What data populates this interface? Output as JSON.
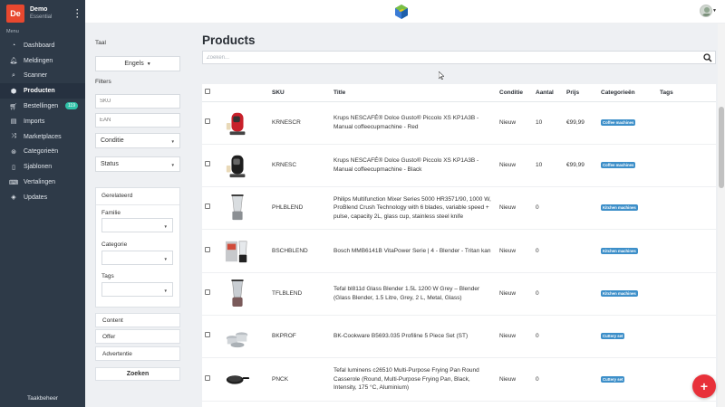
{
  "brand": {
    "initials": "De",
    "name": "Demo",
    "plan": "Essential"
  },
  "sidebar": {
    "menu_label": "Menu",
    "items": [
      {
        "label": "Dashboard",
        "icon": "dashboard-icon",
        "glyph": "◔",
        "active": false
      },
      {
        "label": "Meldingen",
        "icon": "bell-icon",
        "glyph": "🔔︎",
        "active": false
      },
      {
        "label": "Scanner",
        "icon": "search-icon",
        "glyph": "⌕",
        "active": false
      },
      {
        "label": "Producten",
        "icon": "cube-icon",
        "glyph": "⬢",
        "active": true
      },
      {
        "label": "Bestellingen",
        "icon": "cart-icon",
        "glyph": "🛒︎",
        "active": false,
        "badge": "119"
      },
      {
        "label": "Imports",
        "icon": "database-icon",
        "glyph": "▤",
        "active": false
      },
      {
        "label": "Marketplaces",
        "icon": "shuffle-icon",
        "glyph": "⤨",
        "active": false
      },
      {
        "label": "Categorieën",
        "icon": "tags-icon",
        "glyph": "⊛",
        "active": false
      },
      {
        "label": "Sjablonen",
        "icon": "file-icon",
        "glyph": "▯",
        "active": false
      },
      {
        "label": "Vertalingen",
        "icon": "language-icon",
        "glyph": "⌨",
        "active": false
      },
      {
        "label": "Updates",
        "icon": "megaphone-icon",
        "glyph": "◈",
        "active": false
      }
    ],
    "footer_link": "Taakbeheer"
  },
  "filters": {
    "language_label": "Taal",
    "language_value": "Engels",
    "filters_label": "Filters",
    "sku_placeholder": "SKU",
    "ean_placeholder": "EAN",
    "condition_label": "Conditie",
    "status_label": "Status",
    "related": {
      "title": "Gerelateerd",
      "family_label": "Familie",
      "category_label": "Categorie",
      "tags_label": "Tags"
    },
    "content_label": "Content",
    "offer_label": "Offer",
    "ad_label": "Advertentie",
    "search_button": "Zoeken"
  },
  "main": {
    "title": "Products",
    "search_placeholder": "Zoeken..."
  },
  "table": {
    "columns": {
      "sku": "SKU",
      "title": "Title",
      "condition": "Conditie",
      "quantity": "Aantal",
      "price": "Prijs",
      "categories": "Categorieën",
      "tags": "Tags"
    },
    "rows": [
      {
        "thumb": "red-coffee-machine",
        "sku": "KRNESCR",
        "title": "Krups NESCAFÉ® Dolce Gusto® Piccolo XS KP1A3B - Manual coffeecupmachine - Red",
        "condition": "Nieuw",
        "quantity": "10",
        "price": "€99,99",
        "category": "Coffee machines"
      },
      {
        "thumb": "black-coffee-machine",
        "sku": "KRNESC",
        "title": "Krups NESCAFÉ® Dolce Gusto® Piccolo XS KP1A3B - Manual coffeecupmachine - Black",
        "condition": "Nieuw",
        "quantity": "10",
        "price": "€99,99",
        "category": "Coffee machines"
      },
      {
        "thumb": "blender",
        "sku": "PHLBLEND",
        "title": "Philips Multifunction Mixer Series 5000 HR3571/90, 1000 W, ProBlend Crush Technology with 6 blades, variable speed + pulse, capacity 2L, glass cup, stainless steel knife",
        "condition": "Nieuw",
        "quantity": "0",
        "price": "",
        "category": "Kitchen machines"
      },
      {
        "thumb": "blender-box",
        "sku": "BSCHBLEND",
        "title": "Bosch MMB6141B VitaPower Serie | 4 - Blender - Tritan kan",
        "condition": "Nieuw",
        "quantity": "0",
        "price": "",
        "category": "Kitchen machines"
      },
      {
        "thumb": "glass-blender",
        "sku": "TFLBLEND",
        "title": "Tefal bl811d Glass Blender 1.5L 1200 W Grey – Blender (Glass Blender, 1.5 Litre, Grey, 2 L, Metal, Glass)",
        "condition": "Nieuw",
        "quantity": "0",
        "price": "",
        "category": "Kitchen machines"
      },
      {
        "thumb": "cookware-set",
        "sku": "BKPROF",
        "title": "BK-Cookware B5693.035 Profiline 5 Piece Set (ST)",
        "condition": "Nieuw",
        "quantity": "0",
        "price": "",
        "category": "Cuttery set"
      },
      {
        "thumb": "frying-pan",
        "sku": "PNCK",
        "title": "Tefal luminens c26510 Multi-Purpose Frying Pan Round Casserole (Round, Multi-Purpose Frying Pan, Black, Intensity, 175 °C, Aluminium)",
        "condition": "Nieuw",
        "quantity": "0",
        "price": "",
        "category": "Cuttery set"
      }
    ]
  },
  "fab": {
    "label": "+"
  },
  "colors": {
    "sidebar": "#2e3a48",
    "brand": "#e8482f",
    "tag": "#3d8fc9",
    "badge": "#2fc1a8",
    "fab": "#e8313a",
    "panel": "#eef0f3"
  }
}
